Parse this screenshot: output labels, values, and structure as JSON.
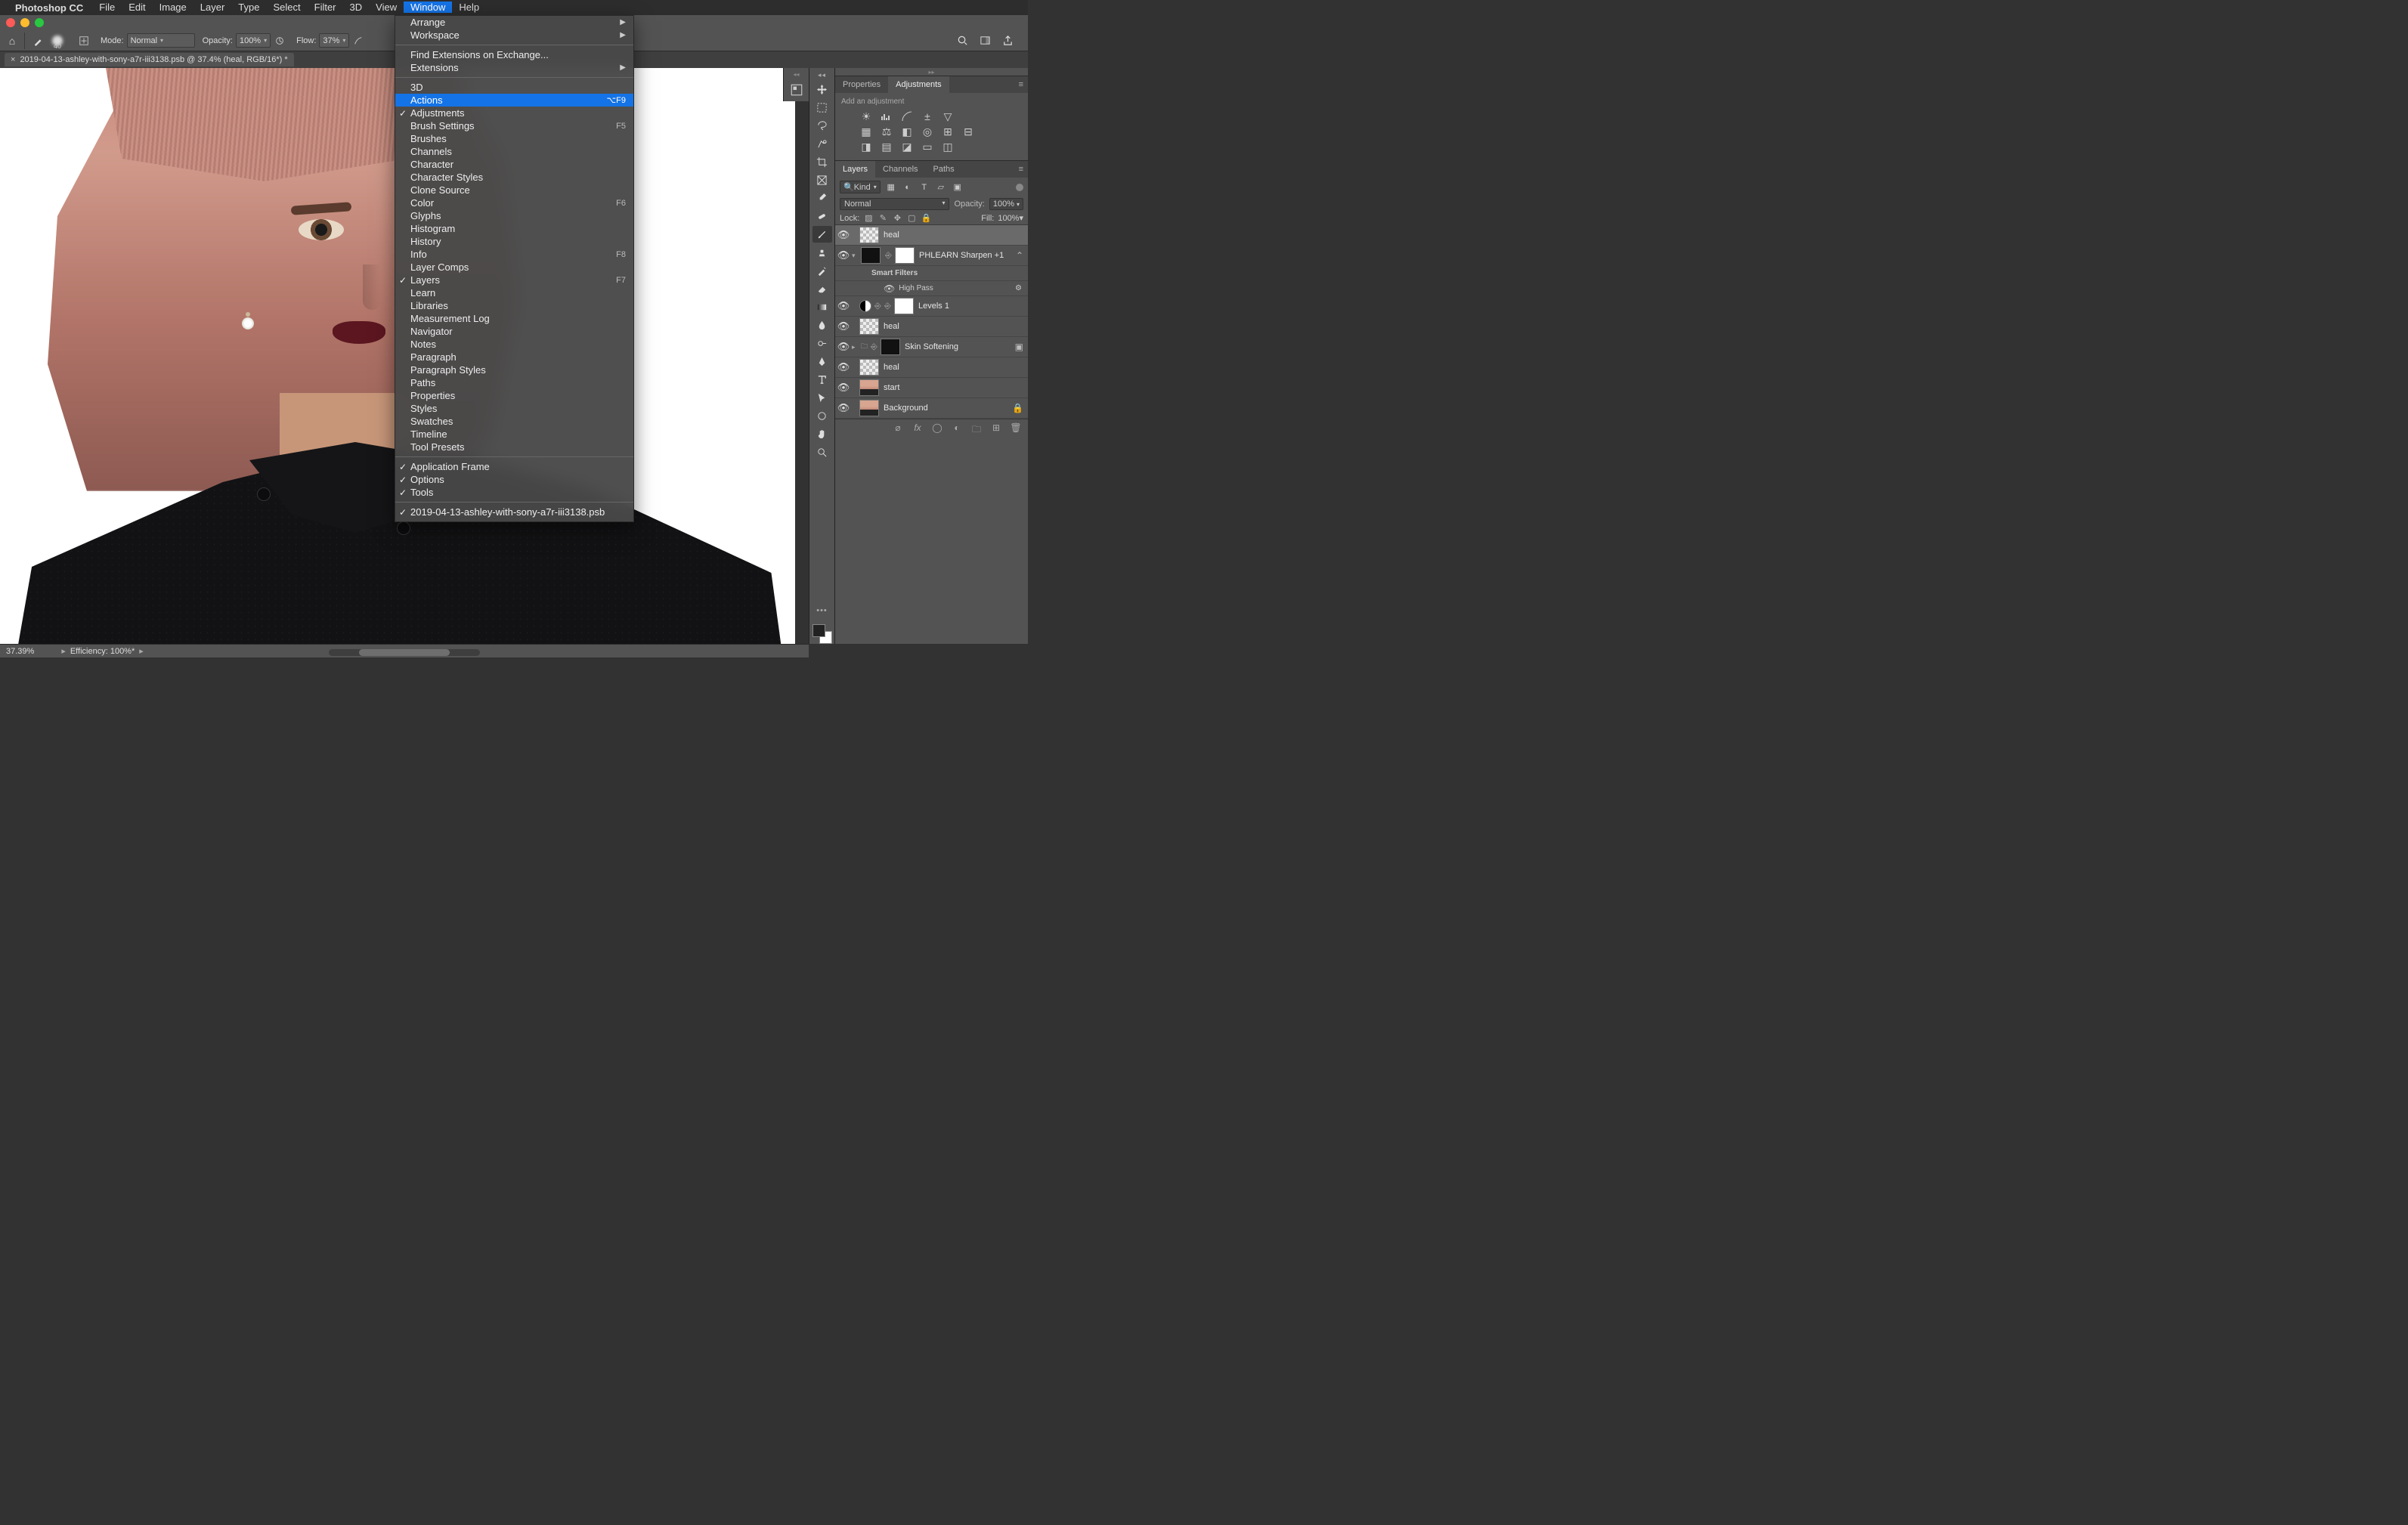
{
  "menubar": {
    "appname": "Photoshop CC",
    "items": [
      "File",
      "Edit",
      "Image",
      "Layer",
      "Type",
      "Select",
      "Filter",
      "3D",
      "View",
      "Window",
      "Help"
    ],
    "open_index": 9
  },
  "optbar": {
    "brush_size": "40",
    "mode_label": "Mode:",
    "mode_value": "Normal",
    "opacity_label": "Opacity:",
    "opacity_value": "100%",
    "flow_label": "Flow:",
    "flow_value": "37%"
  },
  "doctab": {
    "title": "2019-04-13-ashley-with-sony-a7r-iii3138.psb @ 37.4% (heal, RGB/16*) *"
  },
  "window_menu": {
    "sections": [
      [
        {
          "label": "Arrange",
          "submenu": true
        },
        {
          "label": "Workspace",
          "submenu": true
        }
      ],
      [
        {
          "label": "Find Extensions on Exchange..."
        },
        {
          "label": "Extensions",
          "submenu": true
        }
      ],
      [
        {
          "label": "3D"
        },
        {
          "label": "Actions",
          "shortcut": "⌥F9",
          "highlight": true
        },
        {
          "label": "Adjustments",
          "checked": true
        },
        {
          "label": "Brush Settings",
          "shortcut": "F5"
        },
        {
          "label": "Brushes"
        },
        {
          "label": "Channels"
        },
        {
          "label": "Character"
        },
        {
          "label": "Character Styles"
        },
        {
          "label": "Clone Source"
        },
        {
          "label": "Color",
          "shortcut": "F6"
        },
        {
          "label": "Glyphs"
        },
        {
          "label": "Histogram"
        },
        {
          "label": "History"
        },
        {
          "label": "Info",
          "shortcut": "F8"
        },
        {
          "label": "Layer Comps"
        },
        {
          "label": "Layers",
          "shortcut": "F7",
          "checked": true
        },
        {
          "label": "Learn"
        },
        {
          "label": "Libraries"
        },
        {
          "label": "Measurement Log"
        },
        {
          "label": "Navigator"
        },
        {
          "label": "Notes"
        },
        {
          "label": "Paragraph"
        },
        {
          "label": "Paragraph Styles"
        },
        {
          "label": "Paths"
        },
        {
          "label": "Properties"
        },
        {
          "label": "Styles"
        },
        {
          "label": "Swatches"
        },
        {
          "label": "Timeline"
        },
        {
          "label": "Tool Presets"
        }
      ],
      [
        {
          "label": "Application Frame",
          "checked": true
        },
        {
          "label": "Options",
          "checked": true
        },
        {
          "label": "Tools",
          "checked": true
        }
      ],
      [
        {
          "label": "2019-04-13-ashley-with-sony-a7r-iii3138.psb",
          "checked": true
        }
      ]
    ]
  },
  "properties_panel": {
    "tab1": "Properties",
    "tab2": "Adjustments",
    "hint": "Add an adjustment"
  },
  "layers_panel": {
    "tab1": "Layers",
    "tab2": "Channels",
    "tab3": "Paths",
    "kind_label": "Kind",
    "blend_mode": "Normal",
    "opacity_label": "Opacity:",
    "opacity_value": "100%",
    "lock_label": "Lock:",
    "fill_label": "Fill:",
    "fill_value": "100%",
    "layers": [
      {
        "name": "heal",
        "thumb": "checker",
        "selected": true
      },
      {
        "name": "PHLEARN Sharpen +1",
        "thumb": "dark",
        "smart": true,
        "collapse": "open",
        "mask": true
      },
      {
        "sf_label": "Smart Filters",
        "is_sublabel": true
      },
      {
        "sf_item": "High Pass",
        "is_sf_item": true
      },
      {
        "name": "Levels 1",
        "thumb": "white",
        "adj": true,
        "mask": true
      },
      {
        "name": "heal",
        "thumb": "checker"
      },
      {
        "name": "Skin Softening",
        "thumb": "dark",
        "group": true,
        "mask": true,
        "fx": true
      },
      {
        "name": "heal",
        "thumb": "checker"
      },
      {
        "name": "start",
        "thumb": "port"
      },
      {
        "name": "Background",
        "thumb": "port",
        "locked": true
      }
    ]
  },
  "statusbar": {
    "zoom": "37.39%",
    "efficiency": "Efficiency: 100%*"
  }
}
